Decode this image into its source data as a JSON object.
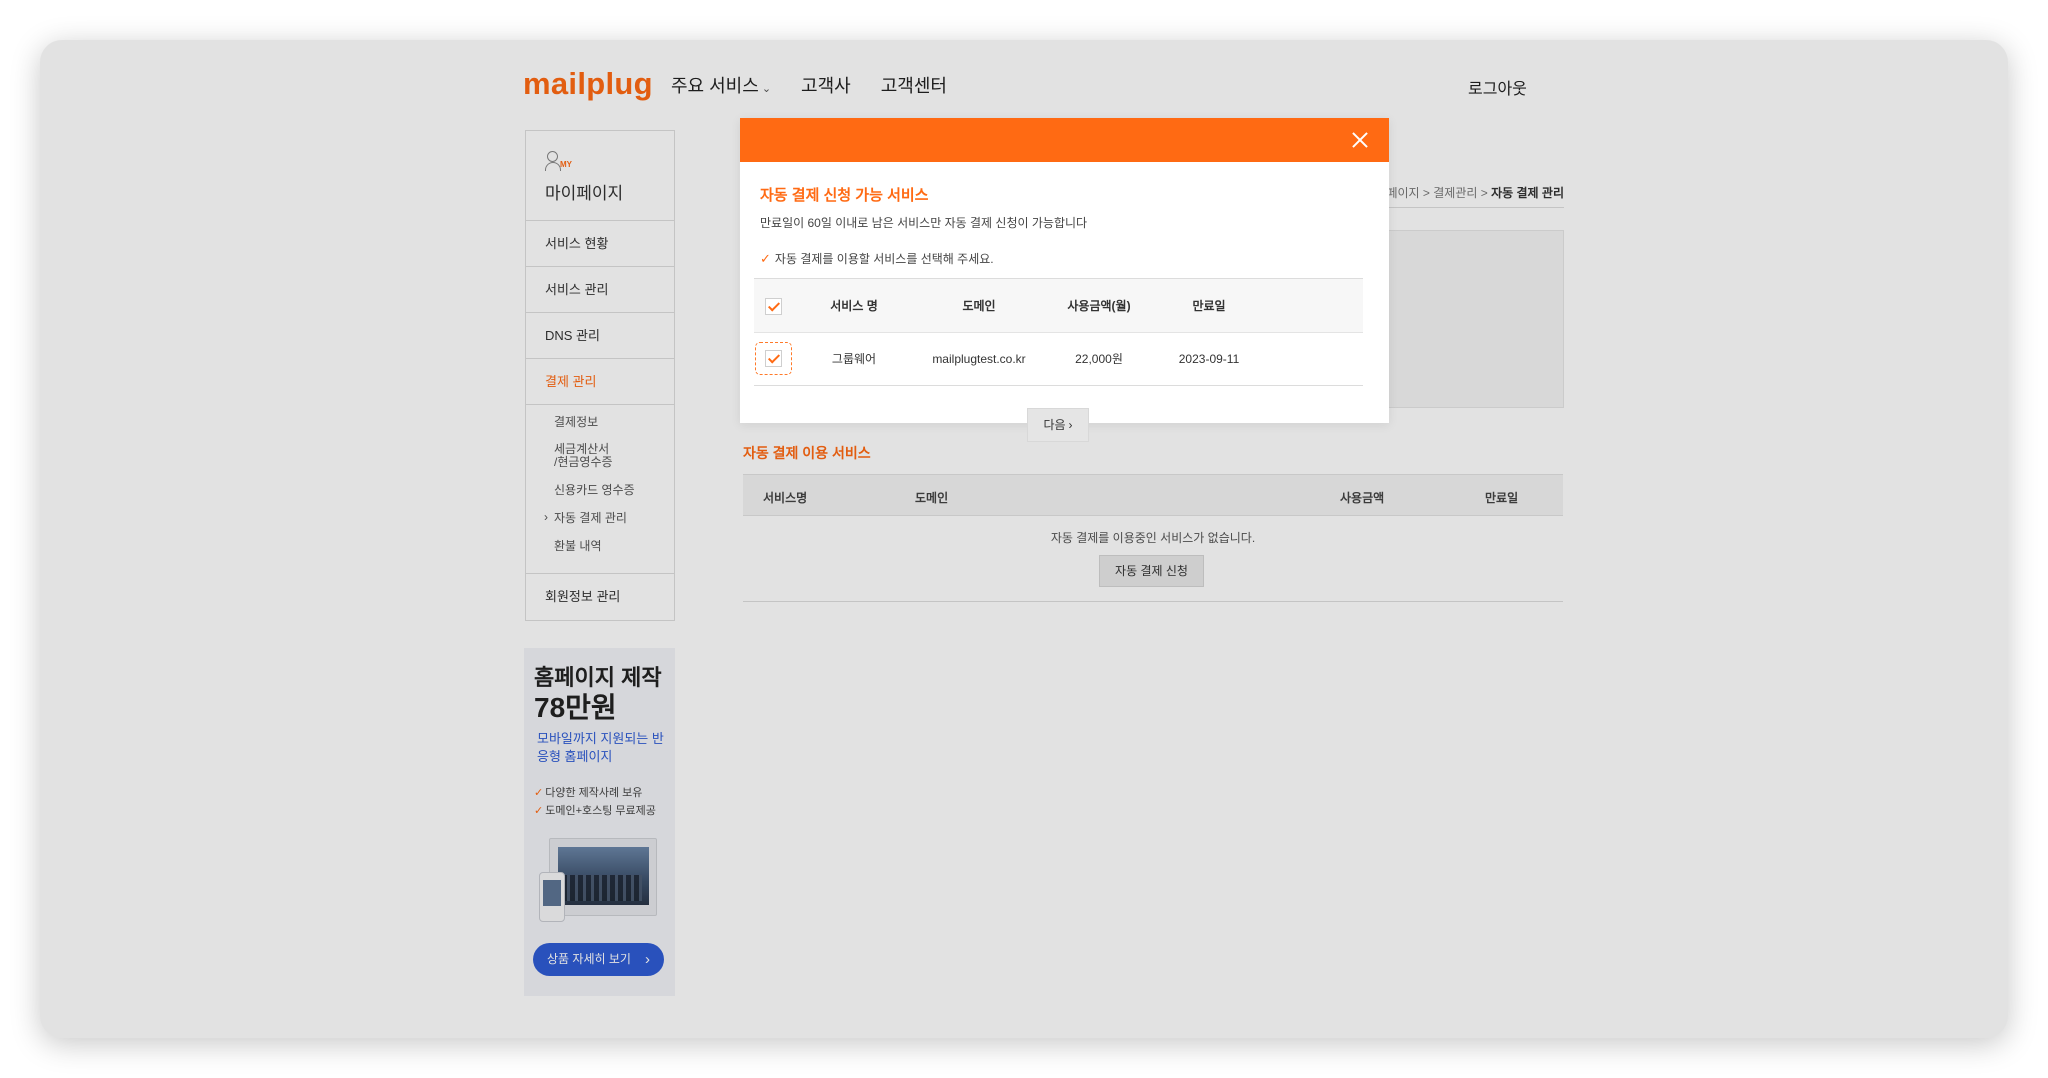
{
  "header": {
    "logo": "mailplug",
    "nav": [
      {
        "label": "주요 서비스",
        "has_dropdown": true
      },
      {
        "label": "고객사"
      },
      {
        "label": "고객센터"
      }
    ],
    "logout": "로그아웃"
  },
  "sidebar": {
    "my_badge": "MY",
    "title": "마이페이지",
    "items": [
      {
        "label": "서비스 현황"
      },
      {
        "label": "서비스 관리"
      },
      {
        "label": "DNS 관리"
      },
      {
        "label": "결제 관리",
        "active": true
      }
    ],
    "sub_items": [
      {
        "label": "결제정보"
      },
      {
        "label": "세금계산서\n/현금영수증"
      },
      {
        "label": "신용카드 영수증"
      },
      {
        "label": "자동 결제 관리",
        "current": true
      },
      {
        "label": "환불 내역"
      }
    ],
    "last_item": "회원정보 관리"
  },
  "banner": {
    "title": "홈페이지 제작",
    "price": "78만원",
    "subtitle": "모바일까지 지원되는 반응형 홈페이지",
    "features": [
      "다양한 제작사례 보유",
      "도메인+호스팅 무료제공"
    ],
    "button": "상품 자세히 보기"
  },
  "breadcrumb": {
    "path": "페이지 > 결제관리 > ",
    "current": "자동 결제 관리"
  },
  "auto_service": {
    "title": "자동 결제 이용 서비스",
    "columns": [
      "서비스명",
      "도메인",
      "사용금액",
      "만료일"
    ],
    "empty_message": "자동 결제를 이용중인 서비스가 없습니다.",
    "apply_button": "자동 결제 신청"
  },
  "modal": {
    "title": "자동 결제 신청 가능 서비스",
    "description": "만료일이 60일 이내로 남은 서비스만 자동 결제 신청이 가능합니다",
    "note": "자동 결제를 이용할 서비스를 선택해 주세요.",
    "columns": [
      "서비스 명",
      "도메인",
      "사용금액(월)",
      "만료일"
    ],
    "rows": [
      {
        "checked": true,
        "service": "그룹웨어",
        "domain": "mailplugtest.co.kr",
        "amount": "22,000원",
        "expires": "2023-09-11"
      }
    ],
    "next_button": "다음"
  },
  "colors": {
    "accent": "#ff6a13",
    "banner_blue": "#2f5cd5"
  }
}
